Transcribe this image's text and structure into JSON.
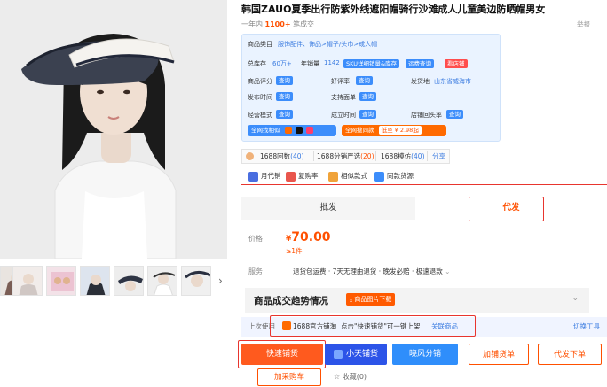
{
  "title": "韩国ZAUO夏季出行防紫外线遮阳帽骑行沙滩成人儿童美边防晒帽男女",
  "meta": {
    "prefix": "一年内",
    "count": "1100+",
    "suffix": "笔成交",
    "report": "举报"
  },
  "info": {
    "category_label": "商品类目",
    "category_value": "服饰配件、饰品>帽子/头巾>成人帽",
    "stock_label": "总库存",
    "stock_value": "60万+",
    "sales_label": "年销量",
    "sales_value": "1142",
    "sku_tag": "SKU详细销量&库存",
    "freight_tag": "运费查询",
    "shop_tag": "看店铺",
    "rating_label": "商品评分",
    "good_label": "好评率",
    "ship_label": "发货地",
    "ship_value": "山东省威海市",
    "pub_label": "发布时间",
    "support_label": "支持面单",
    "biz_label": "经营模式",
    "deal_label": "成立时间",
    "shop_head_label": "店铺回头率",
    "query": "查询",
    "same_label": "全网找相似",
    "search_label": "全网搜同款",
    "low_price": "低至 ¥ 2.98起"
  },
  "stats": {
    "cell1_pre": "1688回数",
    "cell1_num": "(40)",
    "cell2_pre": "1688分销严选",
    "cell2_num": "(20)",
    "cell3_pre": "1688模仿",
    "cell3_num": "(40)",
    "share": "分享"
  },
  "analytics": {
    "item1": "月代销",
    "item2": "复购率",
    "item3": "相似款式",
    "item4": "同款货源"
  },
  "tabs": {
    "left": "批发",
    "right": "代发"
  },
  "price": {
    "label": "价格",
    "currency": "¥",
    "amount": "70.00",
    "unit": "≥1件"
  },
  "service": {
    "label": "服务",
    "text": "退货包运费 · 7天无理由退货 · 晚发必赔 · 极速退款"
  },
  "trend": {
    "title": "商品成交趋势情况",
    "button": "商品图片下载"
  },
  "previous": {
    "label": "上次使用",
    "platform": "1688官方铺淘",
    "hint": "点击\"快速铺货\"可一键上架",
    "link": "关联商品",
    "switch": "切换工具"
  },
  "actions": {
    "fast": "快速铺货",
    "xiaotian": "小天铺货",
    "xiaofeng": "晓风分销",
    "jiaxiao": "加铺货单",
    "daifa": "代发下单",
    "cart": "加采购车",
    "fav": "收藏(0)"
  },
  "colors": {
    "accent": "#ff5000",
    "blue": "#3c8dfb",
    "frame": "#e8352e"
  }
}
